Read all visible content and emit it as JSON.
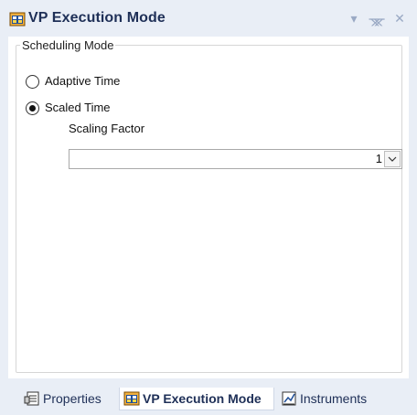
{
  "window": {
    "title": "VP Execution Mode",
    "icon": "vp-execution-icon",
    "buttons": [
      "dropdown-arrow-icon",
      "pin-icon",
      "close-icon"
    ]
  },
  "group": {
    "legend": "Scheduling Mode",
    "options": [
      {
        "label": "Adaptive Time",
        "selected": false
      },
      {
        "label": "Scaled Time",
        "selected": true
      }
    ],
    "scaling_factor": {
      "label": "Scaling Factor",
      "value": "1",
      "icon": "chevron-down-icon"
    }
  },
  "tabs": [
    {
      "label": "Properties",
      "icon": "properties-icon",
      "active": false
    },
    {
      "label": "VP Execution Mode",
      "icon": "vp-execution-icon",
      "active": true
    },
    {
      "label": "Instruments",
      "icon": "instruments-icon",
      "active": false
    }
  ],
  "colors": {
    "chrome_bg": "#e9eef6",
    "title_text": "#1e2f57",
    "panel_bg": "#ffffff"
  }
}
